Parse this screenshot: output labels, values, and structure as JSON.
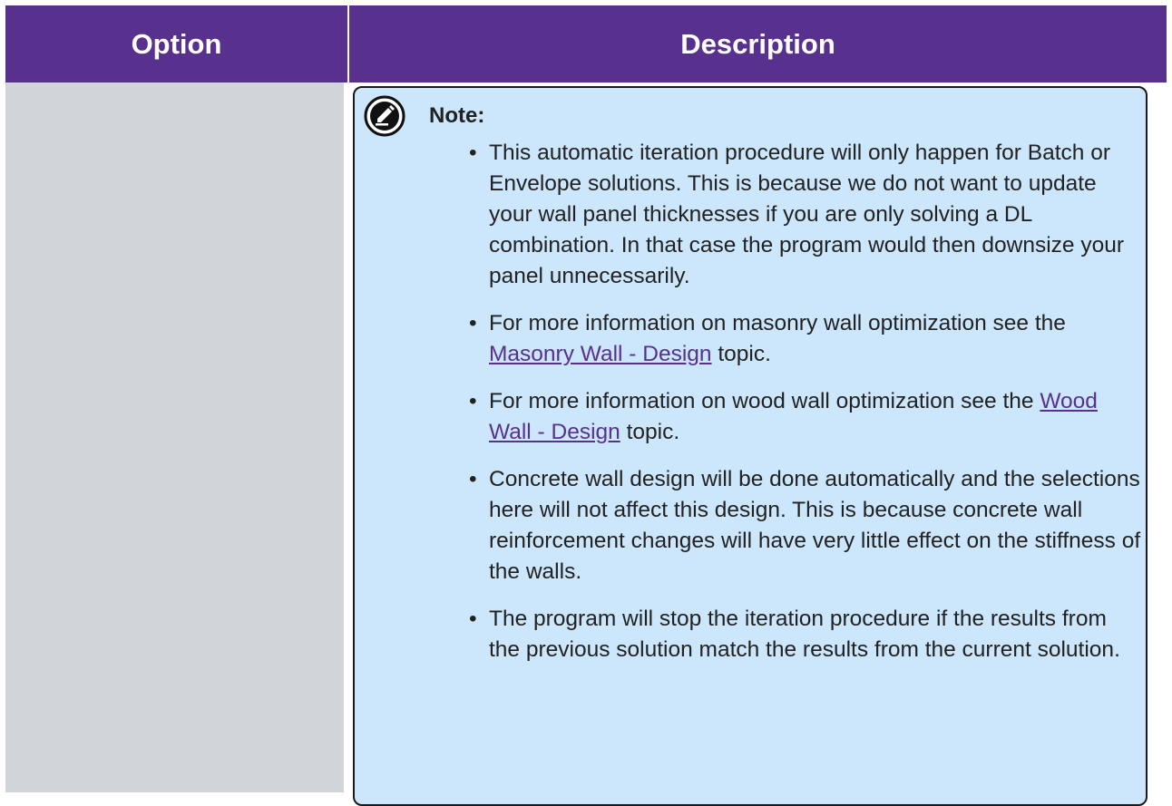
{
  "table": {
    "headers": [
      "Option",
      "Description"
    ]
  },
  "note": {
    "title": "Note:",
    "items": [
      {
        "text": "This automatic iteration procedure will only happen for Batch or Envelope solutions. This is because we do not want to update your wall panel thicknesses if you are only solving a DL combination. In that case the program would then downsize your panel unnecessarily."
      },
      {
        "prefix": "For more information on masonry wall optimization see the ",
        "link": "Masonry Wall - Design",
        "suffix": " topic."
      },
      {
        "prefix": "For more information on wood wall optimization see the ",
        "link": "Wood Wall - Design",
        "suffix": " topic."
      },
      {
        "text": "Concrete wall design will be done automatically and the selections here will not affect this design. This is because concrete wall reinforcement changes will have very little effect on the stiffness of the walls."
      },
      {
        "text": "The program will stop the iteration procedure if the results from the previous solution match the results from the current solution."
      }
    ],
    "icon": "note-icon"
  },
  "colors": {
    "header_bg": "#58318f",
    "option_cell_bg": "#d1d4d8",
    "note_bg": "#cce6fb",
    "link": "#58318f"
  }
}
